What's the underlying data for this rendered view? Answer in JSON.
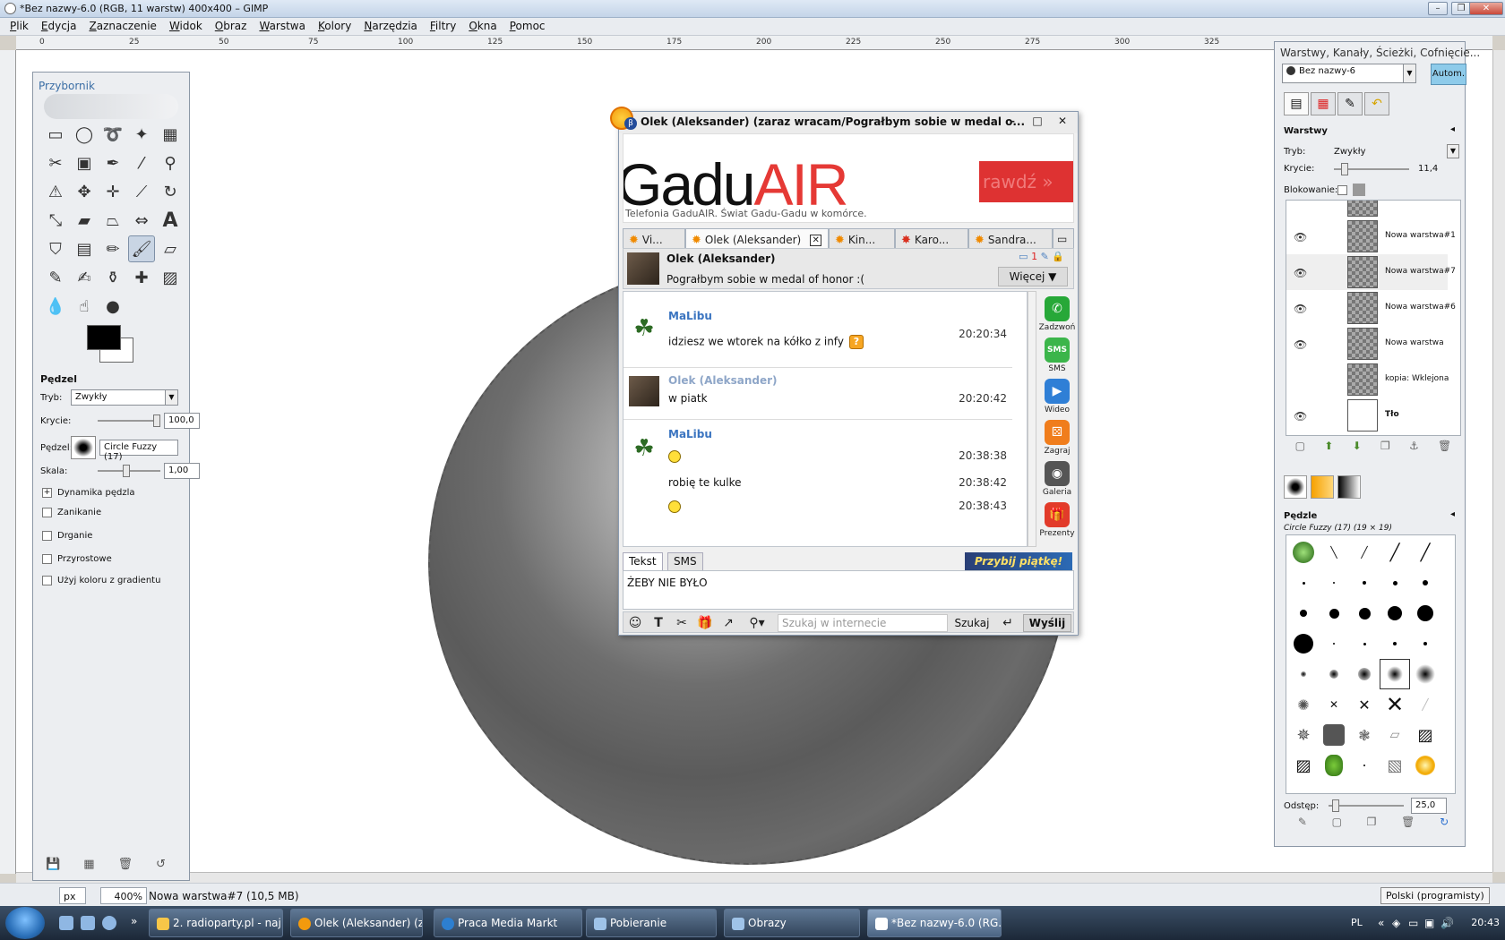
{
  "gimp": {
    "title": "*Bez nazwy-6.0 (RGB, 11 warstw) 400x400 – GIMP",
    "menu": [
      "Plik",
      "Edycja",
      "Zaznaczenie",
      "Widok",
      "Obraz",
      "Warstwa",
      "Kolory",
      "Narzędzia",
      "Filtry",
      "Okna",
      "Pomoc"
    ],
    "ruler_ticks": [
      "0",
      "25",
      "50",
      "75",
      "100",
      "125",
      "150",
      "175",
      "200",
      "225",
      "250",
      "275",
      "300",
      "325"
    ],
    "status": {
      "unit": "px",
      "zoom": "400%",
      "layer_info": "Nowa warstwa#7 (10,5 MB)",
      "lang": "Polski (programisty)"
    }
  },
  "toolbox": {
    "title": "Przybornik",
    "brush_options": {
      "title": "Pędzel",
      "mode_label": "Tryb:",
      "mode_value": "Zwykły",
      "opacity_label": "Krycie:",
      "opacity_value": "100,0",
      "brush_label": "Pędzel:",
      "brush_value": "Circle Fuzzy (17)",
      "scale_label": "Skala:",
      "scale_value": "1,00",
      "dynamics": "Dynamika pędzla",
      "checks": [
        "Zanikanie",
        "Drganie",
        "Przyrostowe",
        "Użyj koloru z gradientu"
      ]
    }
  },
  "gg": {
    "title": "Olek (Aleksander) (zaraz wracam/Pograłbym sobie w medal o...",
    "banner": {
      "brand_1": "Gadu",
      "brand_2": "AIR",
      "tagline": "Telefonia GaduAIR. Świat Gadu-Gadu w komórce.",
      "cta": "rawdź »"
    },
    "tabs": [
      "Vi...",
      "Olek (Aleksander)",
      "Kin...",
      "Karo...",
      "Sandra..."
    ],
    "contact": {
      "name": "Olek (Aleksander)",
      "status": "Pograłbym sobie w medal of honor :(",
      "more": "Więcej ▼",
      "count": "1"
    },
    "messages": [
      {
        "author": "MaLibu",
        "text": "idziesz we wtorek na kółko z infy",
        "time": "20:20:34"
      },
      {
        "author": "Olek (Aleksander)",
        "text": "w piatk",
        "time": "20:20:42"
      },
      {
        "author": "MaLibu",
        "times": [
          "20:38:38",
          "20:38:42",
          "20:38:43"
        ],
        "text": "robię te kulke"
      }
    ],
    "side": [
      "Zadzwoń",
      "SMS",
      "Wideo",
      "Zagraj",
      "Galeria",
      "Prezenty"
    ],
    "input_tabs": [
      "Tekst",
      "SMS"
    ],
    "promo": "Przybij piątkę!",
    "input_value": "ŻEBY NIE BYŁO",
    "search_placeholder": "Szukaj w internecie",
    "search_button": "Szukaj",
    "send_button": "Wyślij"
  },
  "dock": {
    "title": "Warstwy, Kanały, Ścieżki, Cofnięcie...",
    "image": "Bez nazwy-6",
    "auto": "Autom.",
    "layers_title": "Warstwy",
    "mode_label": "Tryb:",
    "mode_value": "Zwykły",
    "opacity_label": "Krycie:",
    "opacity_value": "11,4",
    "lock_label": "Blokowanie:",
    "layers": [
      "Nowa warstwa#1",
      "Nowa warstwa#7",
      "Nowa warstwa#6",
      "Nowa warstwa",
      "kopia: Wklejona",
      "Tło"
    ],
    "brushes_title": "Pędzle",
    "brush_name": "Circle Fuzzy (17) (19 × 19)",
    "spacing_label": "Odstęp:",
    "spacing_value": "25,0"
  },
  "taskbar": {
    "tasks": [
      "2. radioparty.pl - naj...",
      "Olek (Aleksander) (z...",
      "Praca Media Markt",
      "Pobieranie",
      "Obrazy",
      "*Bez nazwy-6.0 (RG..."
    ],
    "lang": "PL",
    "clock": "20:43"
  }
}
